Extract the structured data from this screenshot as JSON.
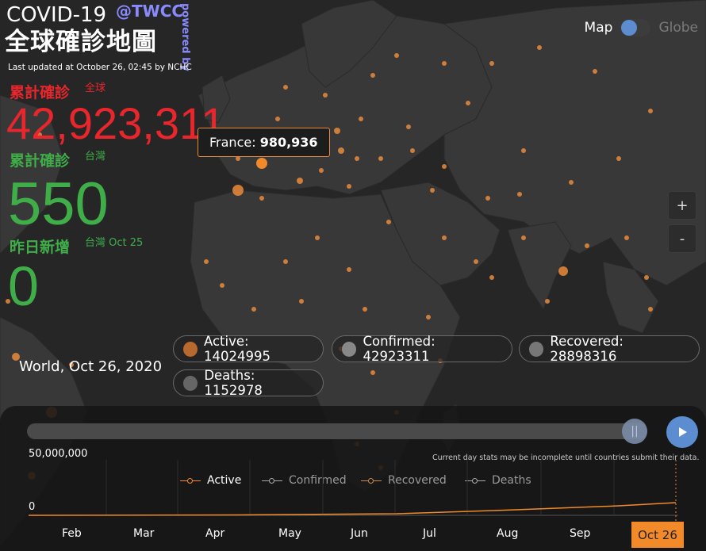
{
  "header": {
    "title_line1": "COVID-19",
    "handle": "@TWCC",
    "title_line2": "全球確診地圖",
    "powered_by": "powered by",
    "updated": "Last updated at October 26, 02:45 by NCHC"
  },
  "stats": {
    "global_label": "累計確診",
    "global_tag": "全球",
    "global_value": "42,923,311",
    "tw_label": "累計確診",
    "tw_tag": "台灣",
    "tw_value": "550",
    "new_label": "昨日新增",
    "new_tag": "台灣 Oct 25",
    "new_value": "0"
  },
  "view_toggle": {
    "left": "Map",
    "right": "Globe"
  },
  "zoom": {
    "in": "+",
    "out": "-"
  },
  "tooltip": {
    "country": "France:",
    "value": "980,936"
  },
  "summary": {
    "location_date": "World, Oct 26, 2020",
    "active": "Active: 14024995",
    "confirmed": "Confirmed: 42923311",
    "recovered": "Recovered: 28898316",
    "deaths": "Deaths: 1152978"
  },
  "timeline": {
    "ymax": "50,000,000",
    "ymin": "0",
    "note": "Current day stats may be incomplete until countries submit their data.",
    "legend": [
      "Active",
      "Confirmed",
      "Recovered",
      "Deaths"
    ],
    "months": [
      "Feb",
      "Mar",
      "Apr",
      "May",
      "Jun",
      "Jul",
      "Aug",
      "Sep"
    ],
    "current": "Oct 26",
    "position": 0.975
  },
  "colors": {
    "accent": "#f28a2a",
    "red": "#e8262c",
    "green": "#3fae49",
    "blue": "#5b8dd0",
    "handle": "#8a8aff"
  }
}
